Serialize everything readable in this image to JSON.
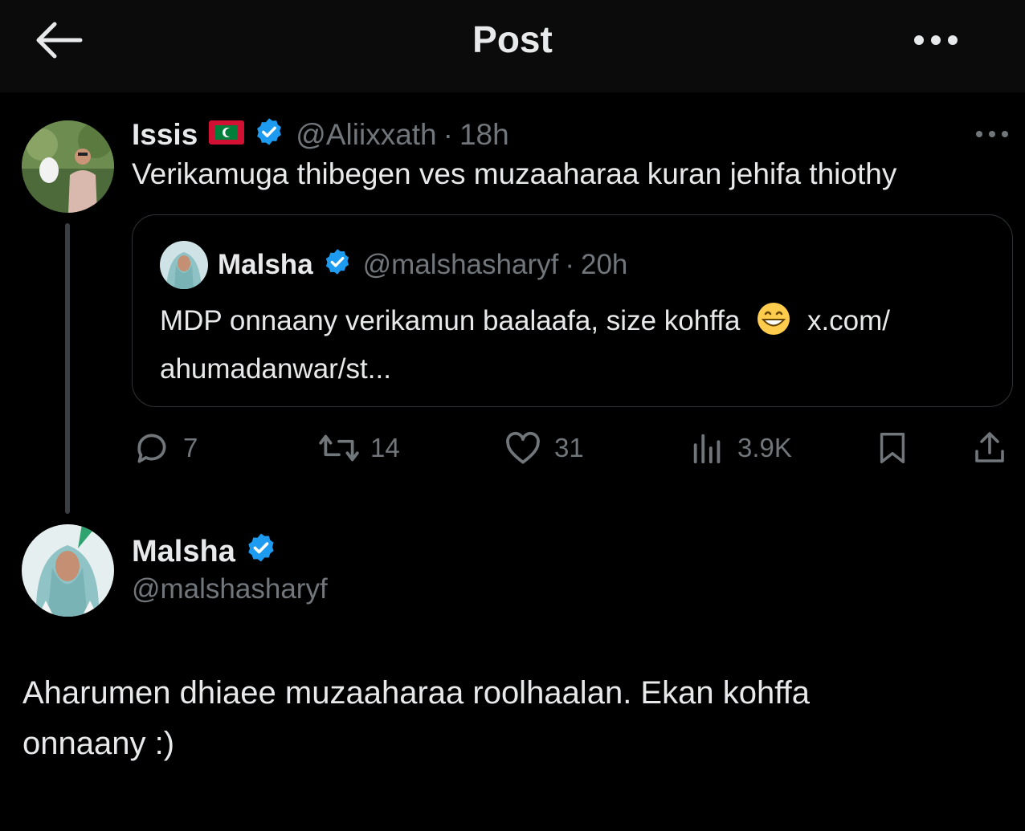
{
  "header": {
    "title": "Post"
  },
  "reply_to_post": {
    "author_name": "Issis",
    "handle": "@Aliixxath",
    "time": "18h",
    "text": "Verikamuga thibegen ves muzaaharaa kuran jehifa thiothy",
    "quoted_post": {
      "author_name": "Malsha",
      "handle": "@malshasharyf",
      "time": "20h",
      "text_line1_part1": "MDP onnaany verikamun baalaafa, size kohffa",
      "text_line1_part2": "x.com/",
      "text_line2": "ahumadanwar/st..."
    },
    "stats": {
      "replies": "7",
      "reposts": "14",
      "likes": "31",
      "views": "3.9K"
    }
  },
  "main_post": {
    "author_name": "Malsha",
    "handle": "@malshasharyf",
    "text_line1": "Aharumen dhiaee muzaaharaa roolhaalan. Ekan kohffa",
    "text_line2": "onnaany :)"
  },
  "colors": {
    "verified": "#1d9bf0",
    "muted": "#71767b",
    "border": "#2f3336",
    "background": "#000000"
  }
}
